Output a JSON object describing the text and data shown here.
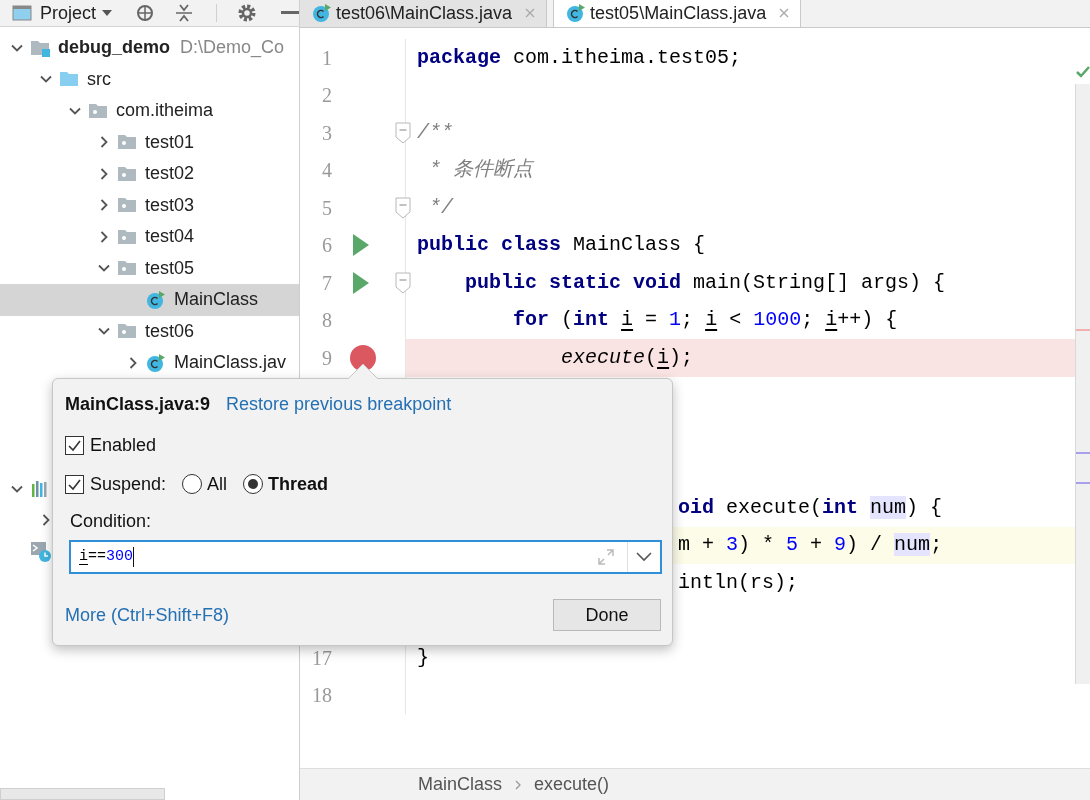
{
  "project_panel": {
    "title": "Project",
    "tree": [
      {
        "label": "debug_demo",
        "path": "D:\\Demo_Co",
        "kind": "module",
        "expanded": true,
        "selected": false,
        "children": [
          {
            "label": "src",
            "kind": "source",
            "expanded": true,
            "selected": false,
            "children": [
              {
                "label": "com.itheima",
                "kind": "package",
                "expanded": true,
                "selected": false,
                "children": [
                  {
                    "label": "test01",
                    "kind": "package",
                    "expanded": false,
                    "selected": false
                  },
                  {
                    "label": "test02",
                    "kind": "package",
                    "expanded": false,
                    "selected": false
                  },
                  {
                    "label": "test03",
                    "kind": "package",
                    "expanded": false,
                    "selected": false
                  },
                  {
                    "label": "test04",
                    "kind": "package",
                    "expanded": false,
                    "selected": false
                  },
                  {
                    "label": "test05",
                    "kind": "package",
                    "expanded": true,
                    "selected": false,
                    "children": [
                      {
                        "label": "MainClass",
                        "kind": "class",
                        "selected": true
                      }
                    ]
                  },
                  {
                    "label": "test06",
                    "kind": "package",
                    "expanded": true,
                    "selected": false,
                    "children": [
                      {
                        "label": "MainClass.jav",
                        "kind": "class",
                        "expanded": false,
                        "selected": false
                      }
                    ]
                  }
                ]
              }
            ]
          }
        ]
      },
      {
        "kind": "library",
        "expanded": true,
        "selected": false,
        "children": [
          {
            "kind": "sdk",
            "expanded": false,
            "selected": false
          }
        ]
      },
      {
        "kind": "scratches",
        "selected": false
      }
    ]
  },
  "editor": {
    "tabs": [
      {
        "label": "test06\\MainClass.java",
        "selected": false
      },
      {
        "label": "test05\\MainClass.java",
        "selected": true
      }
    ],
    "lines": [
      {
        "kind": "full",
        "number": "1",
        "run": false,
        "fold": false,
        "breakpoint": false,
        "tokens": [
          {
            "text": "package",
            "kind": "keyword"
          },
          {
            "text": " com.itheima.test05;",
            "kind": "plain"
          }
        ]
      },
      {
        "kind": "full",
        "number": "2",
        "run": false,
        "fold": false,
        "breakpoint": false
      },
      {
        "kind": "full",
        "number": "3",
        "run": false,
        "fold": true,
        "breakpoint": false,
        "tokens": [
          {
            "text": "/**",
            "kind": "comment"
          }
        ]
      },
      {
        "kind": "full",
        "number": "4",
        "run": false,
        "fold": false,
        "breakpoint": false,
        "tokens": [
          {
            "text": " * 条件断点",
            "kind": "comment"
          }
        ]
      },
      {
        "kind": "full",
        "number": "5",
        "run": false,
        "fold": true,
        "breakpoint": false,
        "tokens": [
          {
            "text": " */",
            "kind": "comment"
          }
        ]
      },
      {
        "kind": "full",
        "number": "6",
        "run": true,
        "fold": false,
        "breakpoint": false,
        "tokens": [
          {
            "text": "public class",
            "kind": "keyword"
          },
          {
            "text": " MainClass {",
            "kind": "plain"
          }
        ]
      },
      {
        "kind": "full",
        "number": "7",
        "run": true,
        "fold": true,
        "breakpoint": false,
        "tokens": [
          {
            "text": "    public static void",
            "kind": "keyword"
          },
          {
            "text": " main(String[] args) {",
            "kind": "plain"
          }
        ]
      },
      {
        "kind": "full",
        "number": "8",
        "run": false,
        "fold": false,
        "breakpoint": false,
        "tokens": [
          {
            "text": "        for",
            "kind": "keyword"
          },
          {
            "text": " (",
            "kind": "plain"
          },
          {
            "text": "int ",
            "kind": "keyword"
          },
          {
            "text": "i",
            "kind": "var"
          },
          {
            "text": " = ",
            "kind": "plain"
          },
          {
            "text": "1",
            "kind": "number"
          },
          {
            "text": "; ",
            "kind": "plain"
          },
          {
            "text": "i",
            "kind": "var"
          },
          {
            "text": " < ",
            "kind": "plain"
          },
          {
            "text": "1000",
            "kind": "number"
          },
          {
            "text": "; ",
            "kind": "plain"
          },
          {
            "text": "i",
            "kind": "var"
          },
          {
            "text": "++) {",
            "kind": "plain"
          }
        ]
      },
      {
        "kind": "full",
        "number": "9",
        "run": false,
        "fold": false,
        "breakpoint": true,
        "tokens": [
          {
            "text": "            execute",
            "kind": "call"
          },
          {
            "text": "(",
            "kind": "plain"
          },
          {
            "text": "i",
            "kind": "var"
          },
          {
            "text": ");",
            "kind": "plain"
          }
        ]
      },
      {
        "kind": "covered"
      },
      {
        "kind": "covered"
      },
      {
        "kind": "covered"
      },
      {
        "kind": "partial",
        "caret_line": false,
        "tokens": [
          {
            "text": "oid",
            "kind": "keyword"
          },
          {
            "text": " execute(",
            "kind": "plain"
          },
          {
            "text": "int ",
            "kind": "keyword"
          },
          {
            "text": "num",
            "kind": "param"
          },
          {
            "text": ") {",
            "kind": "plain"
          }
        ]
      },
      {
        "kind": "partial",
        "caret_line": true,
        "tokens": [
          {
            "text": "m + ",
            "kind": "plain"
          },
          {
            "text": "3",
            "kind": "number"
          },
          {
            "text": ") * ",
            "kind": "plain"
          },
          {
            "text": "5",
            "kind": "number"
          },
          {
            "text": " + ",
            "kind": "plain"
          },
          {
            "text": "9",
            "kind": "number"
          },
          {
            "text": ") / ",
            "kind": "plain"
          },
          {
            "text": "num",
            "kind": "param"
          },
          {
            "text": ";",
            "kind": "plain"
          }
        ]
      },
      {
        "kind": "partial",
        "caret_line": false,
        "tokens": [
          {
            "text": "intln(rs);",
            "kind": "plain"
          }
        ]
      },
      {
        "kind": "covered"
      },
      {
        "kind": "full",
        "number": "17",
        "run": false,
        "fold": false,
        "breakpoint": false,
        "tokens": [
          {
            "text": "}",
            "kind": "plain"
          }
        ]
      },
      {
        "kind": "full",
        "number": "18",
        "run": false,
        "fold": false,
        "breakpoint": false
      }
    ],
    "breadcrumbs": [
      "MainClass",
      "execute()"
    ]
  },
  "breakpoint_popup": {
    "title": "MainClass.java:9",
    "restore_link": "Restore previous breakpoint",
    "enabled": {
      "label": "Enabled",
      "checked": true
    },
    "suspend": {
      "label": "Suspend:",
      "checked": true,
      "options": [
        {
          "label": "All",
          "selected": false
        },
        {
          "label": "Thread",
          "selected": true
        }
      ]
    },
    "condition": {
      "label": "Condition:",
      "tokens": [
        {
          "text": "i",
          "kind": "var"
        },
        {
          "text": "==",
          "kind": "plain"
        },
        {
          "text": "300",
          "kind": "number"
        }
      ]
    },
    "more_link": "More (Ctrl+Shift+F8)",
    "done_button": "Done"
  }
}
